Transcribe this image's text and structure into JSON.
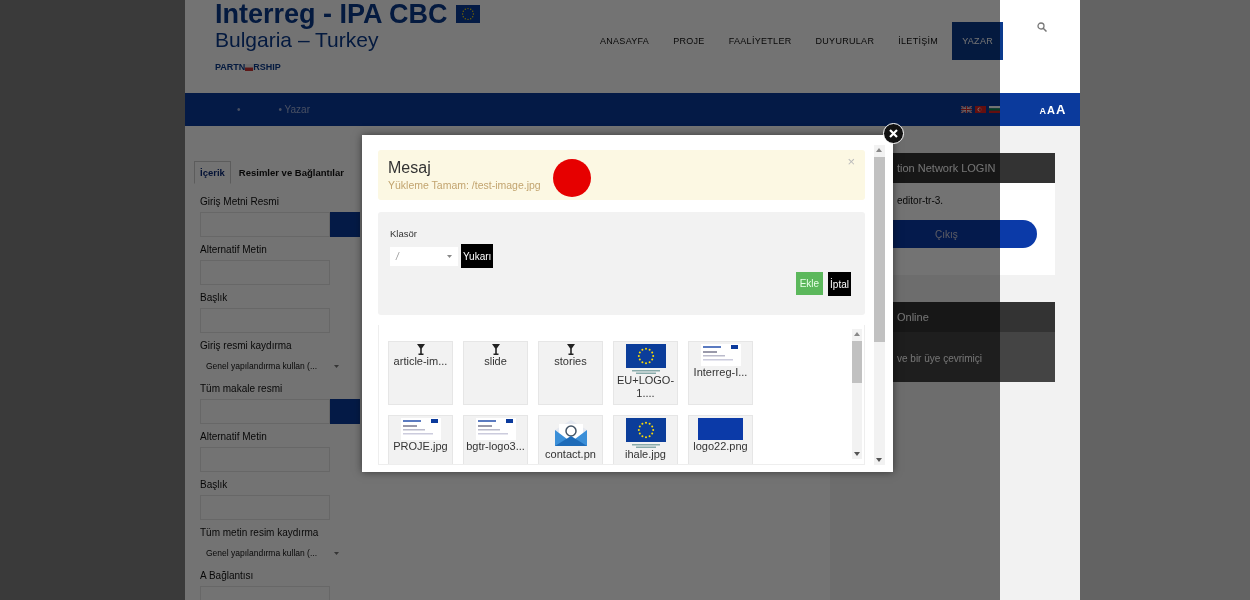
{
  "header": {
    "logo_line_1": "Interreg - IPA CBC",
    "logo_line_2": "Bulgaria – Turkey",
    "tagline_start": "PARTN",
    "tagline_end": "RSHIP",
    "menu": [
      {
        "label": "ANASAYFA",
        "selected": false
      },
      {
        "label": "PROJE",
        "selected": false
      },
      {
        "label": "FAALİYETLER",
        "selected": false
      },
      {
        "label": "DUYURULAR",
        "selected": false
      },
      {
        "label": "İLETİŞİM",
        "selected": false
      },
      {
        "label": "YAZAR",
        "selected": true
      }
    ]
  },
  "breadcrumb": [
    "•",
    "• Yazar"
  ],
  "font_sizes": [
    "A",
    "A",
    "A"
  ],
  "form": {
    "tabs": [
      {
        "label": "İçerik",
        "selected": true
      },
      {
        "label": "Resimler ve Bağlantılar",
        "selected": false
      }
    ],
    "fields": [
      {
        "label": "Giriş Metni Resmi"
      },
      {
        "kind": "text",
        "label": "Alternatif Metin"
      },
      {
        "kind": "text",
        "label": "Başlık"
      },
      {
        "kind": "select",
        "label": "Giriş resmi kaydırma",
        "value": "Genel yapılandırma kullan (..."
      },
      {
        "label": "Tüm makale resmi"
      },
      {
        "kind": "text",
        "label": "Alternatif Metin"
      },
      {
        "kind": "text",
        "label": "Başlık"
      },
      {
        "kind": "select",
        "label": "Tüm metin resim kaydırma",
        "value": "Genel yapılandırma kullan (..."
      },
      {
        "kind": "text",
        "label": "A Bağlantısı"
      }
    ]
  },
  "sidebar": {
    "login": {
      "title": "tion Network LOGIN",
      "user": "editor-tr-3.",
      "button": "Çıkış"
    },
    "online": {
      "title": "Online",
      "text": "ve bir üye çevrimiçi"
    }
  },
  "modal": {
    "message": {
      "title": "Mesaj",
      "text": "Yükleme Tamam: /test-image.jpg",
      "close": "×"
    },
    "folder_label": "Klasör",
    "folder_value": "/",
    "up_button": "Yukarı",
    "insert_button": "Ekle",
    "cancel_button": "İptal",
    "files": [
      {
        "kind": "folder",
        "name": "article-im..."
      },
      {
        "kind": "folder",
        "name": "slide"
      },
      {
        "kind": "folder",
        "name": "stories"
      },
      {
        "kind": "flag",
        "name": "EU+LOGO-1...."
      },
      {
        "kind": "document",
        "name": "Interreg-I..."
      },
      {
        "kind": "document",
        "name": "PROJE.jpg"
      },
      {
        "kind": "document",
        "name": "bgtr-logo3..."
      },
      {
        "kind": "mail",
        "name": "contact.pn"
      },
      {
        "kind": "flag",
        "name": "ihale.jpg"
      },
      {
        "kind": "banner",
        "name": "logo22.png"
      }
    ]
  }
}
